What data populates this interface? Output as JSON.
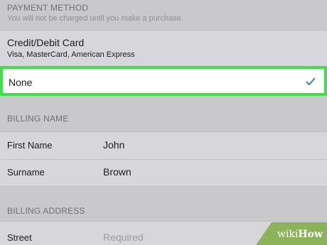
{
  "payment": {
    "section_title": "PAYMENT METHOD",
    "section_subtitle": "You will not be charged until you make a purchase.",
    "options": [
      {
        "label": "Credit/Debit Card",
        "detail": "Visa, MasterCard, American Express",
        "selected": false
      },
      {
        "label": "None",
        "selected": true
      }
    ]
  },
  "billing_name": {
    "section_title": "BILLING NAME",
    "rows": [
      {
        "label": "First Name",
        "value": "John"
      },
      {
        "label": "Surname",
        "value": "Brown"
      }
    ]
  },
  "billing_address": {
    "section_title": "BILLING ADDRESS",
    "rows": [
      {
        "label": "Street",
        "placeholder": "Required"
      }
    ]
  },
  "icons": {
    "selected_check": "checkmark-icon"
  },
  "colors": {
    "highlight": "#3ee04a",
    "check": "#2f7fd6",
    "watermark": "#8cb35a"
  },
  "watermark": {
    "wiki": "wiki",
    "how": "How"
  }
}
